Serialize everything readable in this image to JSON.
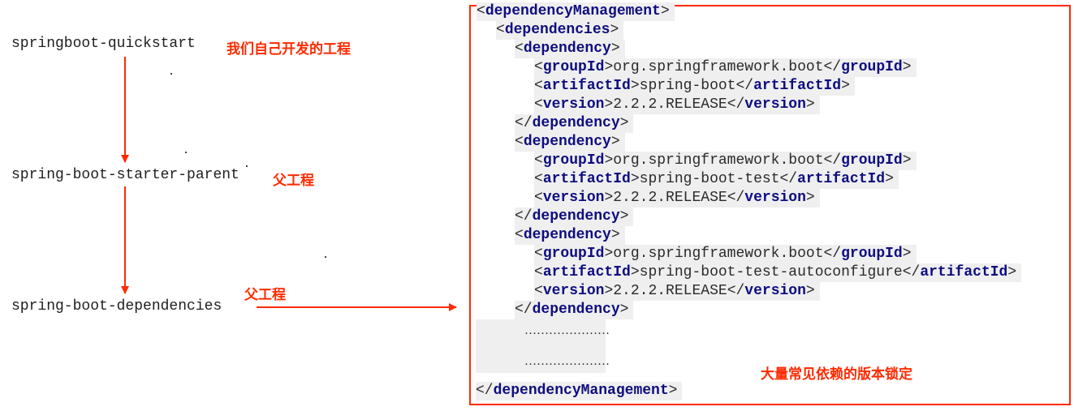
{
  "projects": {
    "quickstart": {
      "name": "springboot-quickstart",
      "label": "我们自己开发的工程"
    },
    "parent": {
      "name": "spring-boot-starter-parent",
      "label": "父工程"
    },
    "dependencies": {
      "name": "spring-boot-dependencies",
      "label": "父工程"
    }
  },
  "xml": {
    "dm_open_tag": "dependencyManagement",
    "deps_open_tag": "dependencies",
    "dependency_tag": "dependency",
    "groupId_tag": "groupId",
    "artifactId_tag": "artifactId",
    "version_tag": "version",
    "dependency_items": [
      {
        "groupId": "org.springframework.boot",
        "artifactId": "spring-boot",
        "version": "2.2.2.RELEASE"
      },
      {
        "groupId": "org.springframework.boot",
        "artifactId": "spring-boot-test",
        "version": "2.2.2.RELEASE"
      },
      {
        "groupId": "org.springframework.boot",
        "artifactId": "spring-boot-test-autoconfigure",
        "version": "2.2.2.RELEASE"
      }
    ],
    "ellipsis_1": "…………………",
    "ellipsis_2": "…………………",
    "dm_close_tag": "dependencyManagement"
  },
  "annotation": "大量常见依赖的版本锁定",
  "colors": {
    "accent": "#ff2a00",
    "tag": "#0d0d80",
    "code_bg": "#efefef"
  }
}
